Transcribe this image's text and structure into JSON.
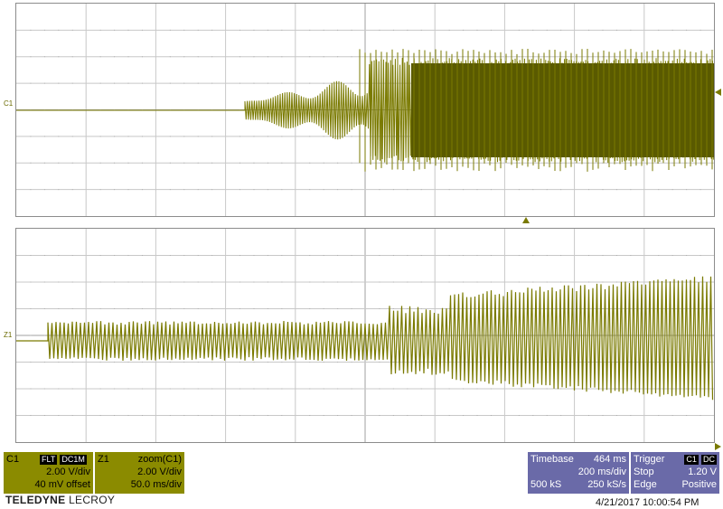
{
  "waveform": {
    "top_channel_label": "C1",
    "bottom_channel_label": "Z1",
    "trace_color": "#7a7a00",
    "trace_dark_color": "#5a5a00",
    "grid_color": "#c8c8c8"
  },
  "c1_box": {
    "name": "C1",
    "tag1": "FLT",
    "tag2": "DC1M",
    "vdiv": "2.00 V/div",
    "offset": "40 mV offset"
  },
  "z1_box": {
    "name": "Z1",
    "source": "zoom(C1)",
    "vdiv": "2.00 V/div",
    "tdiv": "50.0 ms/div"
  },
  "timebase": {
    "label": "Timebase",
    "offset": "464 ms",
    "tdiv": "200 ms/div",
    "samples": "500 kS",
    "rate": "250 kS/s"
  },
  "trigger": {
    "label": "Trigger",
    "tag1": "C1",
    "tag2": "DC",
    "state": "Stop",
    "level": "1.20 V",
    "type": "Edge",
    "slope": "Positive"
  },
  "brand": {
    "bold": "TELEDYNE",
    "light": "LECROY"
  },
  "timestamp": "4/21/2017 10:00:54 PM"
}
